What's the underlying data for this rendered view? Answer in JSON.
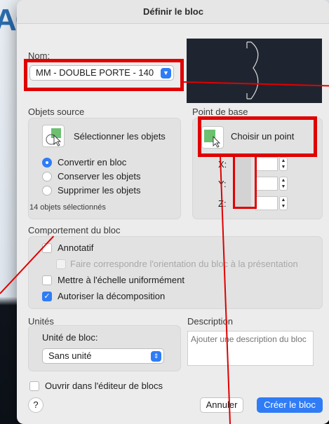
{
  "dialog": {
    "title": "Définir le bloc"
  },
  "name": {
    "label": "Nom:",
    "value": "MM - DOUBLE PORTE - 140"
  },
  "source": {
    "title": "Objets source",
    "select_button": "Sélectionner les objets",
    "options": [
      "Convertir en bloc",
      "Conserver les objets",
      "Supprimer les objets"
    ],
    "selected_index": 0,
    "count_text": "14 objets sélectionnés"
  },
  "base_point": {
    "title": "Point de base",
    "pick_button": "Choisir un point",
    "x_label": "X:",
    "y_label": "Y:",
    "z_label": "Z:"
  },
  "behavior": {
    "title": "Comportement du bloc",
    "annotative": "Annotatif",
    "match_orientation": "Faire correspondre l'orientation du bloc à la présentation",
    "scale_uniform": "Mettre à l'échelle uniformément",
    "allow_explode": "Autoriser la décomposition",
    "annotative_checked": false,
    "scale_checked": false,
    "explode_checked": true
  },
  "units": {
    "title": "Unités",
    "label": "Unité de bloc:",
    "value": "Sans unité"
  },
  "description": {
    "title": "Description",
    "placeholder": "Ajouter une description du bloc"
  },
  "footer": {
    "open_in_editor": "Ouvrir dans l'éditeur de blocs",
    "help": "?",
    "cancel": "Annuler",
    "create": "Créer le bloc"
  },
  "colors": {
    "accent": "#2f7cf6",
    "annotation": "#e00000",
    "preview_bg": "#1f2530"
  }
}
